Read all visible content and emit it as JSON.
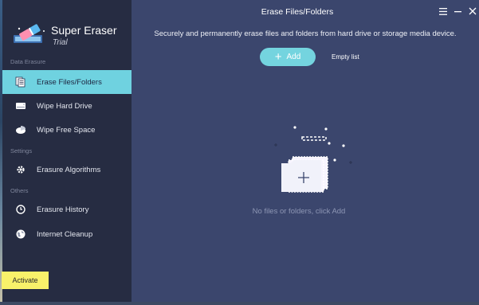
{
  "app": {
    "title": "Super Eraser",
    "edition": "Trial"
  },
  "sidebar": {
    "sections": [
      {
        "label": "Data Erasure"
      },
      {
        "label": "Settings"
      },
      {
        "label": "Others"
      }
    ],
    "items": [
      {
        "label": "Erase Files/Folders",
        "icon": "files-icon",
        "active": true
      },
      {
        "label": "Wipe Hard Drive",
        "icon": "hard-drive-icon"
      },
      {
        "label": "Wipe Free Space",
        "icon": "pie-disk-icon"
      },
      {
        "label": "Erasure Algorithms",
        "icon": "gear-icon"
      },
      {
        "label": "Erasure History",
        "icon": "clock-icon"
      },
      {
        "label": "Internet Cleanup",
        "icon": "globe-icon"
      }
    ],
    "activate_label": "Activate"
  },
  "window": {
    "title": "Erase Files/Folders",
    "menu_icon": "hamburger-icon",
    "minimize_icon": "minimize-icon",
    "close_icon": "close-icon"
  },
  "main": {
    "subtitle": "Securely and permanently erase files and folders from hard drive or storage media device.",
    "add_label": "Add",
    "empty_list_label": "Empty list",
    "empty_message": "No files or folders, click Add"
  },
  "colors": {
    "accent": "#6fd2e0",
    "sidebar_bg": "#262c42",
    "main_bg": "#3b466d",
    "activate": "#f8f16a"
  }
}
